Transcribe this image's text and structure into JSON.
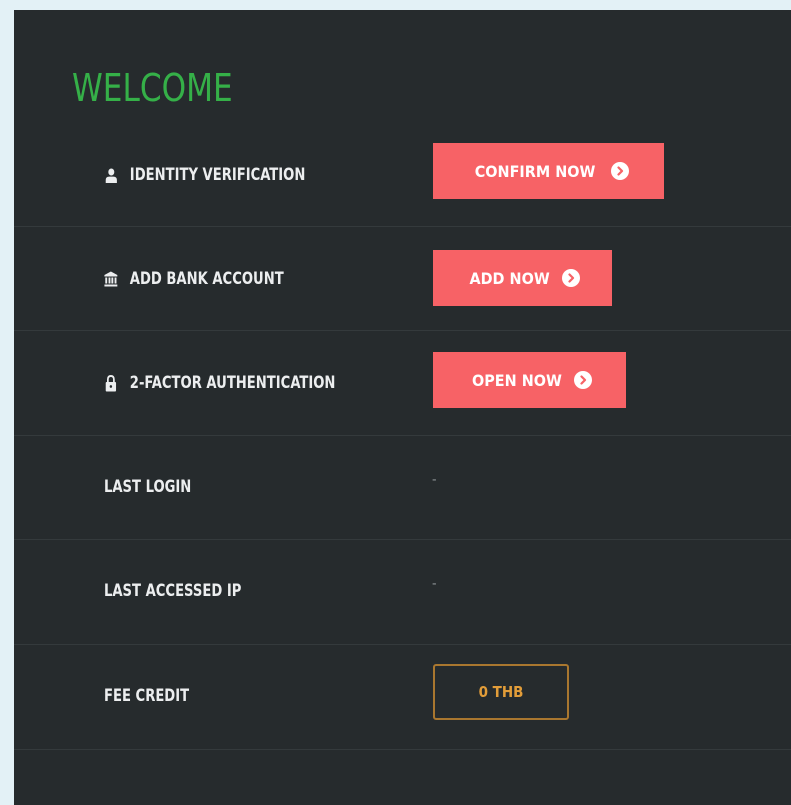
{
  "page": {
    "title": "WELCOME"
  },
  "rows": {
    "identity": {
      "label": "IDENTITY VERIFICATION",
      "button": "CONFIRM NOW",
      "icon": "user-icon"
    },
    "bank": {
      "label": "ADD BANK ACCOUNT",
      "button": "ADD NOW",
      "icon": "bank-icon"
    },
    "twofa": {
      "label": "2-FACTOR AUTHENTICATION",
      "button": "OPEN NOW",
      "icon": "lock-icon"
    },
    "last_login": {
      "label": "LAST LOGIN",
      "value": "-"
    },
    "last_ip": {
      "label": "LAST ACCESSED IP",
      "value": "-"
    },
    "fee_credit": {
      "label": "FEE CREDIT",
      "value": "0 THB"
    }
  },
  "colors": {
    "background": "#262b2d",
    "title": "#35b048",
    "button": "#f76266",
    "fee_border": "#a9772f",
    "fee_text": "#e29d39"
  }
}
